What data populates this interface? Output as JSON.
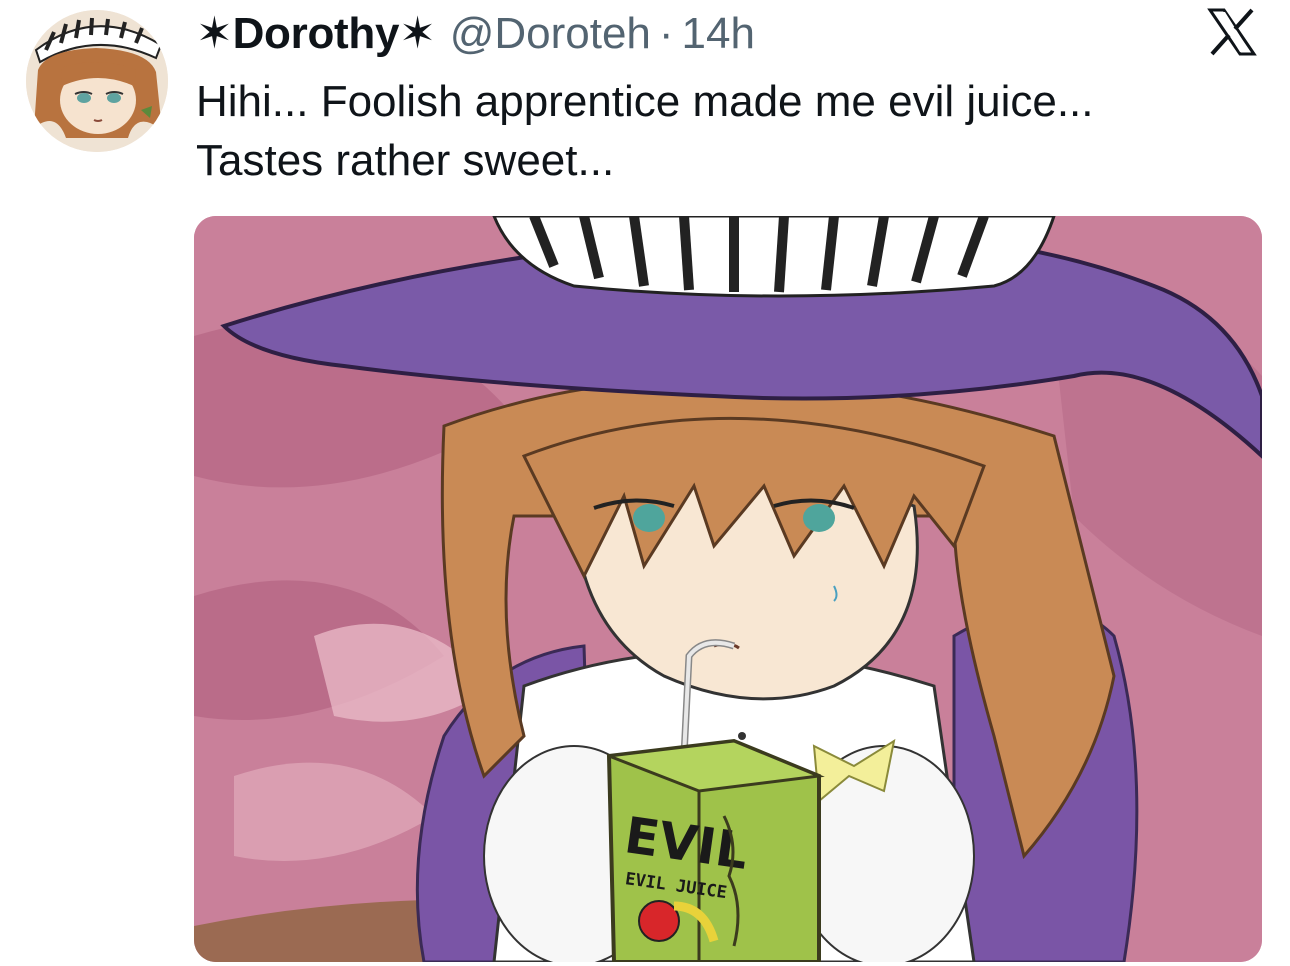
{
  "tweet": {
    "author": {
      "display_name": "✶Dorothy✶",
      "handle": "@Doroteh",
      "avatar_icon": "witch-girl-avatar"
    },
    "separator": "·",
    "timestamp": "14h",
    "text_lines": [
      "Hihi... Foolish apprentice made me evil juice...",
      "Tastes rather sweet..."
    ],
    "media": {
      "box_text": "EVIL",
      "box_subtext": "EVIL JUICE"
    }
  },
  "platform": {
    "logo": "x-logo-icon"
  },
  "colors": {
    "text_primary": "#0f1419",
    "text_secondary": "#536471",
    "hat_purple": "#7a5aa8",
    "background_pink": "#c97a94",
    "hair_orange": "#c98a55",
    "juice_box_green": "#9fc24a"
  }
}
